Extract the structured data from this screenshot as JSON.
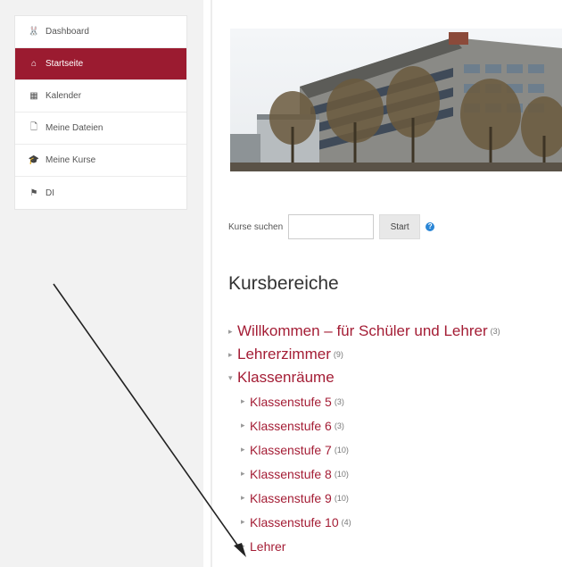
{
  "nav": {
    "items": [
      {
        "label": "Dashboard",
        "icon": "dashboard-icon",
        "glyph": "🐰",
        "active": false
      },
      {
        "label": "Startseite",
        "icon": "home-icon",
        "glyph": "⌂",
        "active": true
      },
      {
        "label": "Kalender",
        "icon": "calendar-icon",
        "glyph": "▦",
        "active": false
      },
      {
        "label": "Meine Dateien",
        "icon": "file-icon",
        "glyph": "🗋",
        "active": false
      },
      {
        "label": "Meine Kurse",
        "icon": "graduation-cap-icon",
        "glyph": "🎓",
        "active": false
      },
      {
        "label": "DI",
        "icon": "flag-icon",
        "glyph": "⚑",
        "active": false
      }
    ]
  },
  "search": {
    "label": "Kurse suchen",
    "value": "",
    "button": "Start",
    "help": "?"
  },
  "heading": "Kursbereiche",
  "categories": [
    {
      "label": "Willkommen – für Schüler und Lehrer",
      "count": "(3)",
      "expanded": false,
      "level": 1
    },
    {
      "label": "Lehrerzimmer",
      "count": "(9)",
      "expanded": false,
      "level": 1
    },
    {
      "label": "Klassenräume",
      "count": "",
      "expanded": true,
      "level": 1
    },
    {
      "label": "Klassenstufe 5",
      "count": "(3)",
      "expanded": false,
      "level": 2
    },
    {
      "label": "Klassenstufe 6",
      "count": "(3)",
      "expanded": false,
      "level": 2
    },
    {
      "label": "Klassenstufe 7",
      "count": "(10)",
      "expanded": false,
      "level": 2
    },
    {
      "label": "Klassenstufe 8",
      "count": "(10)",
      "expanded": false,
      "level": 2
    },
    {
      "label": "Klassenstufe 9",
      "count": "(10)",
      "expanded": false,
      "level": 2
    },
    {
      "label": "Klassenstufe 10",
      "count": "(4)",
      "expanded": false,
      "level": 2
    },
    {
      "label": "Lehrer",
      "count": "",
      "expanded": false,
      "level": 2
    }
  ],
  "colors": {
    "accent": "#9b1b30",
    "link": "#a41d35",
    "sidebar_bg": "#f2f2f2"
  },
  "arrows": {
    "collapsed": "▸",
    "expanded": "▾"
  }
}
